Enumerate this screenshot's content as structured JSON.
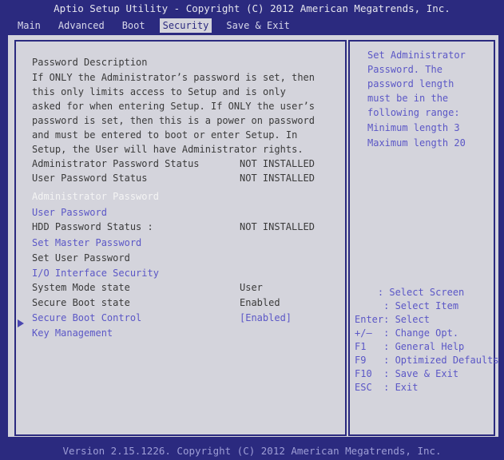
{
  "header": {
    "title": "Aptio Setup Utility - Copyright (C) 2012 American Megatrends, Inc."
  },
  "menu": {
    "tabs": [
      {
        "label": "Main"
      },
      {
        "label": "Advanced"
      },
      {
        "label": "Boot"
      },
      {
        "label": "Security"
      },
      {
        "label": "Save & Exit"
      }
    ],
    "active": "Security"
  },
  "description": {
    "heading": "Password Description",
    "lines": [
      "If ONLY the Administrator’s password is set, then",
      "this only limits access to Setup and is only",
      "asked for when entering Setup. If ONLY the user’s",
      "password is set, then this is a power on password",
      "and must be entered to boot or enter Setup. In",
      "Setup, the User will have Administrator rights."
    ]
  },
  "status": {
    "admin_label": "Administrator Password Status",
    "admin_value": "NOT INSTALLED",
    "user_label": "User Password Status",
    "user_value": "NOT INSTALLED",
    "hdd_label": "HDD Password Status :",
    "hdd_value": "NOT INSTALLED",
    "system_mode_label": "System Mode state",
    "system_mode_value": "User",
    "secure_boot_label": "Secure Boot state",
    "secure_boot_value": "Enabled"
  },
  "items": {
    "admin_password": "Administrator Password",
    "user_password": "User Password",
    "set_master_password": "Set Master Password",
    "set_user_password": "Set User Password",
    "io_interface_security": "I/O Interface Security",
    "secure_boot_control": "Secure Boot Control",
    "secure_boot_control_value": "[Enabled]",
    "key_management": "Key Management"
  },
  "help": {
    "lines": [
      "Set Administrator",
      "Password. The",
      "password length",
      "must be in the",
      "following range:",
      "Minimum length 3",
      "Maximum length 20"
    ]
  },
  "keys": {
    "lines": [
      "    : Select Screen",
      "     : Select Item",
      "Enter: Select",
      "+/–  : Change Opt.",
      "F1   : General Help",
      "F9   : Optimized Defaults",
      "F10  : Save & Exit",
      "ESC  : Exit"
    ]
  },
  "footer": {
    "text": "Version 2.15.1226. Copyright (C) 2012 American Megatrends, Inc."
  }
}
